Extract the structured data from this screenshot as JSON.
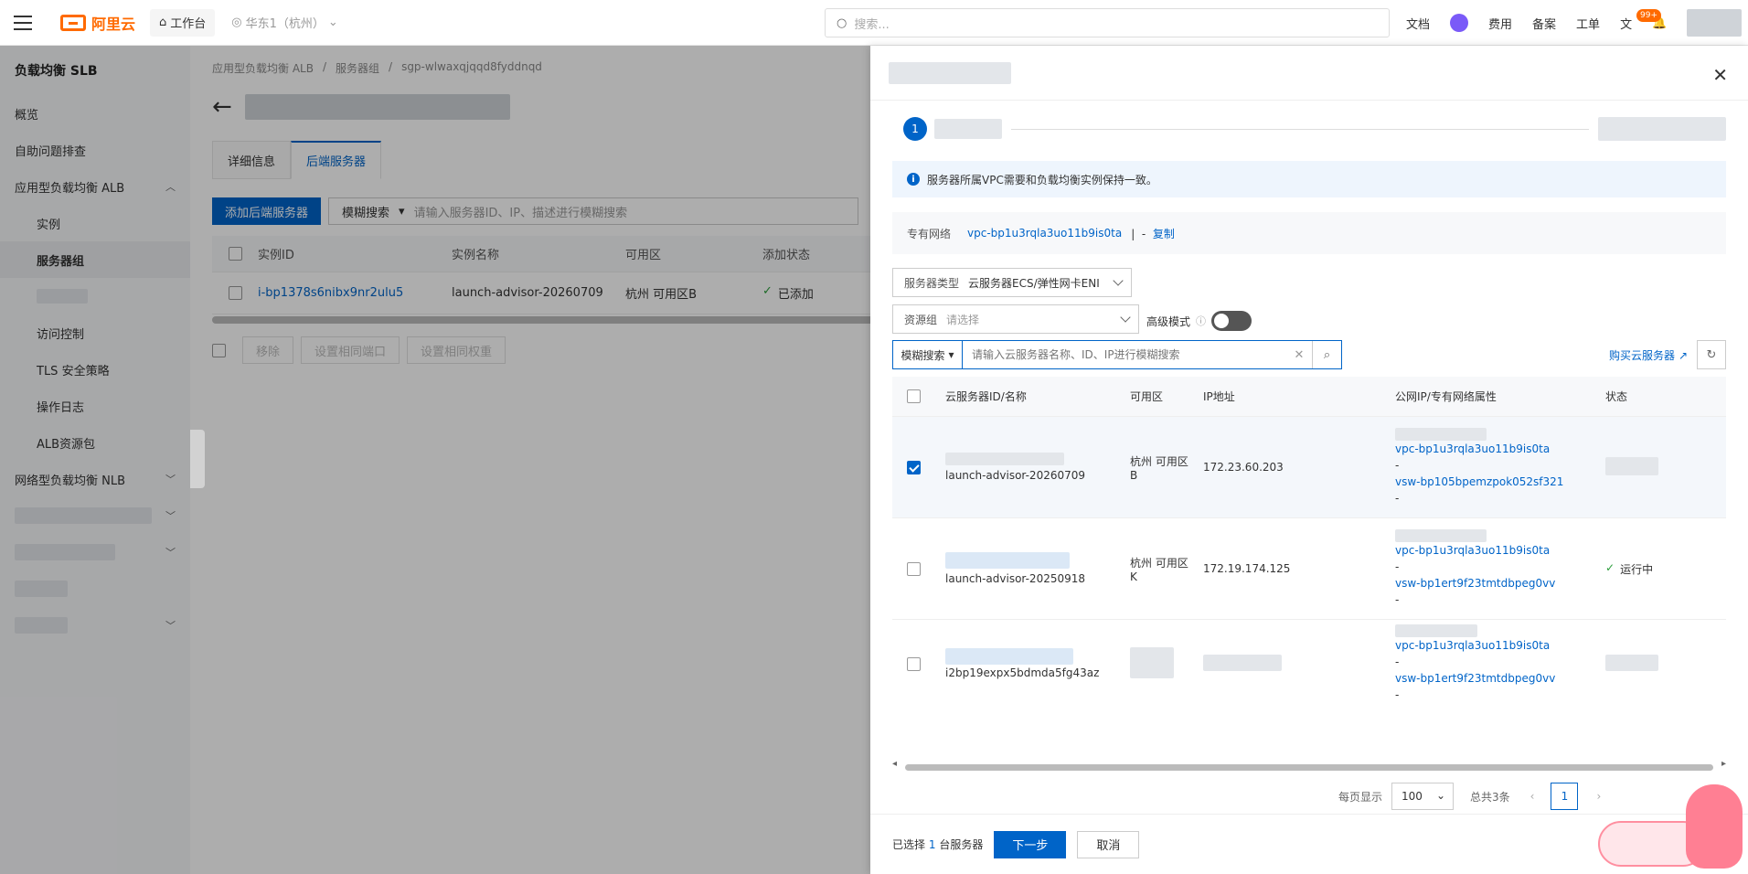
{
  "topbar": {
    "brand": "阿里云",
    "workspace": "工作台",
    "region": "华东1（杭州）",
    "search_placeholder": "搜索...",
    "nav": [
      "文档",
      "费用",
      "备案",
      "工单"
    ],
    "badge": "99+"
  },
  "sidebar": {
    "title": "负载均衡 SLB",
    "items": [
      {
        "label": "概览"
      },
      {
        "label": "自助问题排查"
      },
      {
        "label": "应用型负载均衡 ALB"
      },
      {
        "label": "实例"
      },
      {
        "label": "服务器组"
      },
      {
        "label": ""
      },
      {
        "label": "访问控制"
      },
      {
        "label": "TLS 安全策略"
      },
      {
        "label": "操作日志"
      },
      {
        "label": "ALB资源包"
      },
      {
        "label": "网络型负载均衡 NLB"
      }
    ]
  },
  "main": {
    "breadcrumb": [
      "应用型负载均衡 ALB",
      "服务器组",
      "sgp-wlwaxqjqqd8fyddnqd"
    ],
    "tabs": [
      "详细信息",
      "后端服务器"
    ],
    "add_button": "添加后端服务器",
    "filter_dropdown": "模糊搜索",
    "filter_placeholder": "请输入服务器ID、IP、描述进行模糊搜索",
    "columns": [
      "实例ID",
      "实例名称",
      "可用区",
      "添加状态"
    ],
    "rows": [
      {
        "id": "i-bp1378s6nibx9nr2ulu5",
        "name": "launch-advisor-20260709",
        "zone": "杭州 可用区B",
        "status": "已添加"
      }
    ],
    "bottom_buttons": [
      "移除",
      "设置相同端口",
      "设置相同权重"
    ]
  },
  "drawer": {
    "step": "1",
    "notice": "服务器所属VPC需要和负载均衡实例保持一致。",
    "vpc_label": "专有网络",
    "vpc_id": "vpc-bp1u3rqla3uo11b9is0ta",
    "vpc_sep": "|",
    "vpc_dash": "-",
    "copy": "复制",
    "server_type_label": "服务器类型",
    "server_type_value": "云服务器ECS/弹性网卡ENI",
    "resource_group_label": "资源组",
    "resource_group_placeholder": "请选择",
    "advanced_mode": "高级模式",
    "search_dropdown": "模糊搜索",
    "search_placeholder": "请输入云服务器名称、ID、IP进行模糊搜索",
    "buy_link": "购买云服务器",
    "columns": [
      "云服务器ID/名称",
      "可用区",
      "IP地址",
      "公网IP/专有网络属性",
      "状态"
    ],
    "rows": [
      {
        "name": "launch-advisor-20260709",
        "zone": "杭州 可用区B",
        "ip": "172.23.60.203",
        "vpc": "vpc-bp1u3rqla3uo11b9is0ta",
        "vsw": "vsw-bp105bpemzpok052sf321",
        "dash": "-",
        "status": "",
        "checked": true
      },
      {
        "name": "launch-advisor-20250918",
        "zone": "杭州 可用区K",
        "ip": "172.19.174.125",
        "vpc": "vpc-bp1u3rqla3uo11b9is0ta",
        "vsw": "vsw-bp1ert9f23tmtdbpeg0vv",
        "dash": "-",
        "status": "运行中",
        "checked": false
      },
      {
        "name": "i2bp19expx5bdmda5fg43az",
        "zone": "",
        "ip": "",
        "vpc": "vpc-bp1u3rqla3uo11b9is0ta",
        "vsw": "vsw-bp1ert9f23tmtdbpeg0vv",
        "dash": "-",
        "status": "",
        "checked": false
      }
    ],
    "pager": {
      "per_page_label": "每页显示",
      "per_page": "100",
      "total": "总共3条",
      "page": "1"
    },
    "footer": {
      "selected_prefix": "已选择",
      "selected_count": "1",
      "selected_suffix": "台服务器",
      "next": "下一步",
      "cancel": "取消"
    }
  },
  "colors": {
    "primary": "#0064c8",
    "brand": "#ff6a00"
  }
}
